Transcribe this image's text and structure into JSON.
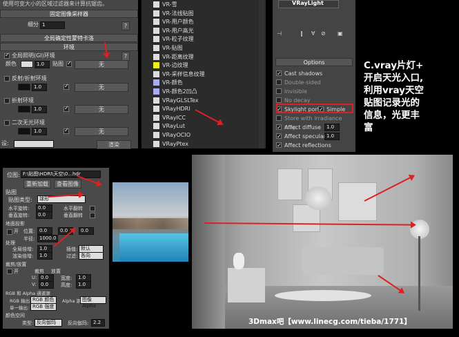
{
  "top_left": {
    "hint_text": "使用可变大小的区域过滤器来计算抗锯齿。",
    "fixed_sampler_header": "固定图像采样器",
    "subdivs_label": "细分",
    "subdivs_value": "1",
    "rollout_header_global": "全局确定性蒙特卡洛",
    "rollout_header_env": "环境",
    "gi_env_label": "全局照明(GI)环境",
    "color_label": "颜色",
    "multiplier_1": "1.0",
    "map_label": "贴图",
    "map_none": "无",
    "refl_env_label": "反射/折射环境",
    "refr_env_label": "折射环境",
    "secondary_matte_label": "二次无光环境",
    "bottom_label": "设:",
    "render_label": "渲染",
    "multiplier_values": [
      "1.0",
      "1.0",
      "1.0"
    ]
  },
  "map_list": {
    "items": [
      "VR-雪",
      "VR-法线贴图",
      "VR-用户颜色",
      "VR-用户高光",
      "VR-粒子纹理",
      "VR-贴图",
      "VR-距离纹理",
      "VR-边纹理",
      "VR-采样信息纹理",
      "VR-颜色",
      "VR-颜色2凹凸",
      "VRayGLSLTex",
      "VRayHDRI",
      "VRayICC",
      "VRayLut",
      "VRayOCIO",
      "VRayPtex"
    ],
    "icon_colors": [
      "#dddddd",
      "#dddddd",
      "#dddddd",
      "#dddddd",
      "#dddddd",
      "#dddddd",
      "#dddddd",
      "#eeee22",
      "#dddddd",
      "#aaaaee",
      "#aaaaee",
      "#dddddd",
      "#dddddd",
      "#dddddd",
      "#dddddd",
      "#dddddd",
      "#dddddd"
    ]
  },
  "light_panel": {
    "object_name": "VRayLight",
    "options_header": "Options",
    "options": [
      {
        "label": "Cast shadows",
        "checked": true
      },
      {
        "label": "Double-sided",
        "checked": false
      },
      {
        "label": "Invisible",
        "checked": false
      },
      {
        "label": "No decay",
        "checked": false
      },
      {
        "label": "Skylight portal",
        "checked": true
      },
      {
        "label": "Simple",
        "checked": true
      },
      {
        "label": "Store with irradiance map",
        "checked": false
      },
      {
        "label": "Affect diffuse",
        "checked": true,
        "value": "1.0"
      },
      {
        "label": "Affect specular",
        "checked": true,
        "value": "1.0"
      },
      {
        "label": "Affect reflections",
        "checked": true
      }
    ]
  },
  "annotation": {
    "lines": [
      "C.vray片灯+",
      "开启天光入口,",
      "利用vray天空",
      "贴图记录光的",
      "信息，光更丰",
      "富"
    ]
  },
  "hdri_panel": {
    "bitmap_label": "位图:",
    "bitmap_path": "F:\\贴图\\HDRI\\天空\\0...hdr",
    "reload_button": "重新加载",
    "view_image_button": "查看图像",
    "map_section": "贴图",
    "map_type_label": "贴图类型:",
    "map_type_value": "球形",
    "h_rotate_label": "水平旋转:",
    "h_rotate_value": "0.0",
    "h_flip_label": "水平翻转",
    "v_rotate_label": "垂直旋转:",
    "v_rotate_value": "0.0",
    "v_flip_label": "垂直翻转",
    "ground_section": "地面投影",
    "ground_on_label": "开",
    "pos_label": "位置:",
    "pos_values": [
      "0.0",
      "0.0",
      "0.0"
    ],
    "radius_label": "半径:",
    "radius_value": "1000.0",
    "process_section": "处理",
    "global_mult_label": "全局倍增:",
    "global_mult_value": "1.0",
    "render_mult_label": "渲染倍增:",
    "render_mult_value": "1.0",
    "interp_label": "插值:",
    "interp_value": "默认",
    "filter_label": "过滤:",
    "filter_value": "各向",
    "crop_section": "裁剪/放置",
    "crop_on_label": "开",
    "crop_label": "裁剪",
    "place_label": "放置",
    "u_label": "U:",
    "v_label": "V:",
    "w_label": "宽度:",
    "h_label": "高度:",
    "uv_values": [
      "0.0",
      "0.0"
    ],
    "wh_values": [
      "1.0",
      "1.0"
    ],
    "rgb_alpha_section": "RGB 和 Alpha 通道源",
    "rgb_out_label": "RGB 输出:",
    "rgb_out_value": "RGB 颜色",
    "alpha_src_label": "Alpha 源:",
    "alpha_src_value": "图像 Alpha",
    "mono_out_label": "单一输出:",
    "mono_out_value": "RGB 强度",
    "color_space_section": "颜色空间",
    "type_label": "类型:",
    "type_value": "反向伽玛",
    "gamma_label": "反向伽玛:",
    "gamma_value": "2.2"
  },
  "footer": {
    "watermark": "3Dmax吧【www.linecg.com/tieba/1771】"
  }
}
